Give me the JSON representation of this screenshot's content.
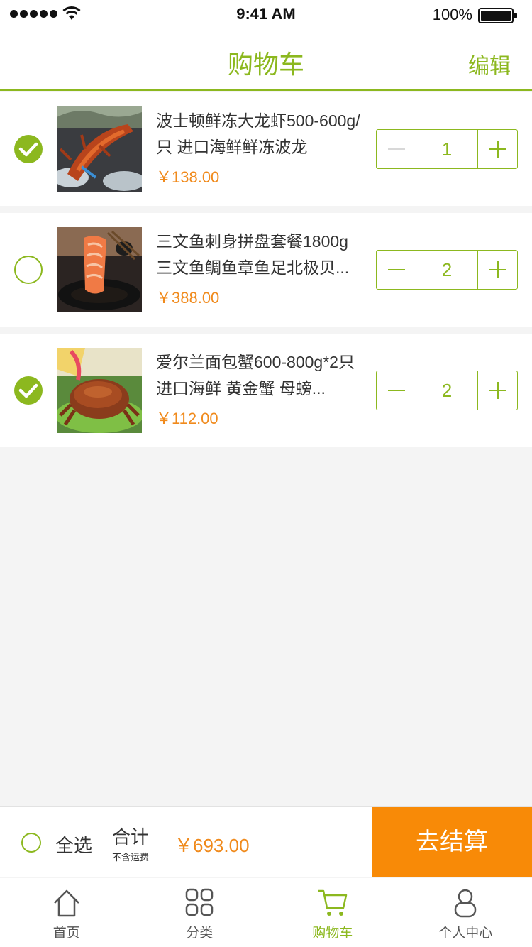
{
  "status_bar": {
    "time": "9:41 AM",
    "battery": "100%"
  },
  "header": {
    "title": "购物车",
    "edit_label": "编辑"
  },
  "colors": {
    "accent": "#8cb81f",
    "price": "#f08a1c",
    "checkout": "#f88a07"
  },
  "items": [
    {
      "title": "波士顿鲜冻大龙虾500-600g/只 进口海鲜鲜冻波龙",
      "price": "￥138.00",
      "qty": "1",
      "checked": true,
      "image": "lobster-image"
    },
    {
      "title": "三文鱼刺身拼盘套餐1800g 三文鱼鲷鱼章鱼足北极贝...",
      "price": "￥388.00",
      "qty": "2",
      "checked": false,
      "image": "salmon-sashimi-image"
    },
    {
      "title": "爱尔兰面包蟹600-800g*2只 进口海鲜 黄金蟹 母螃...",
      "price": "￥112.00",
      "qty": "2",
      "checked": true,
      "image": "crab-image"
    }
  ],
  "checkout": {
    "select_all_label": "全选",
    "total_label": "合计",
    "total_note": "不含运费",
    "total_amount": "￥693.00",
    "button_label": "去结算"
  },
  "tabbar": {
    "tabs": [
      {
        "label": "首页",
        "icon": "home-icon",
        "active": false
      },
      {
        "label": "分类",
        "icon": "category-icon",
        "active": false
      },
      {
        "label": "购物车",
        "icon": "cart-icon",
        "active": true
      },
      {
        "label": "个人中心",
        "icon": "user-icon",
        "active": false
      }
    ]
  }
}
